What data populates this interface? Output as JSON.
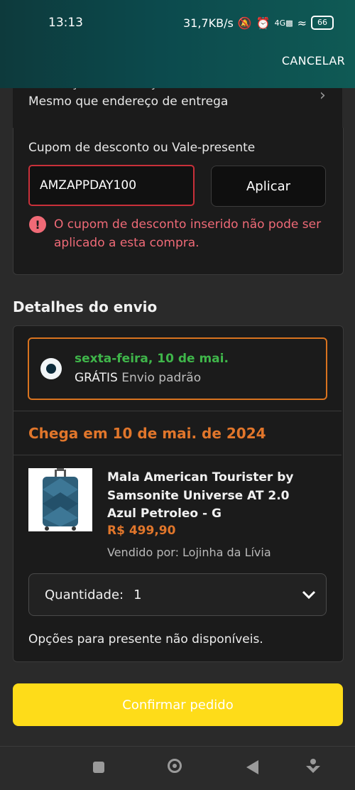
{
  "status_bar": {
    "time": "13:13",
    "speed": "31,7KB/s",
    "signal": "4G",
    "battery": "66"
  },
  "header": {
    "cancel_label": "CANCELAR"
  },
  "billing": {
    "title": "Endereço de cobrança",
    "value": "Mesmo que endereço de entrega"
  },
  "coupon": {
    "label": "Cupom de desconto ou Vale-presente",
    "value": "AMZAPPDAY100",
    "apply_label": "Aplicar",
    "error": "O cupom de desconto inserido não pode ser aplicado a esta compra."
  },
  "shipping": {
    "title": "Detalhes do envio",
    "option": {
      "date": "sexta-feira, 10 de mai.",
      "price": "GRÁTIS",
      "method": "Envio padrão"
    },
    "arrival": "Chega em 10 de mai. de 2024"
  },
  "product": {
    "name": "Mala American Tourister by Samsonite Universe AT 2.0 Azul Petroleo - G",
    "price": "R$ 499,90",
    "seller": "Vendido por: Lojinha da Lívia"
  },
  "quantity": {
    "label": "Quantidade:",
    "value": "1"
  },
  "gift_text": "Opções para presente não disponíveis.",
  "confirm_label": "Confirmar pedido",
  "colors": {
    "accent_orange": "#e1762b",
    "error_red": "#ef6a77",
    "button_yellow": "#fedc19",
    "green": "#3fb64a"
  }
}
